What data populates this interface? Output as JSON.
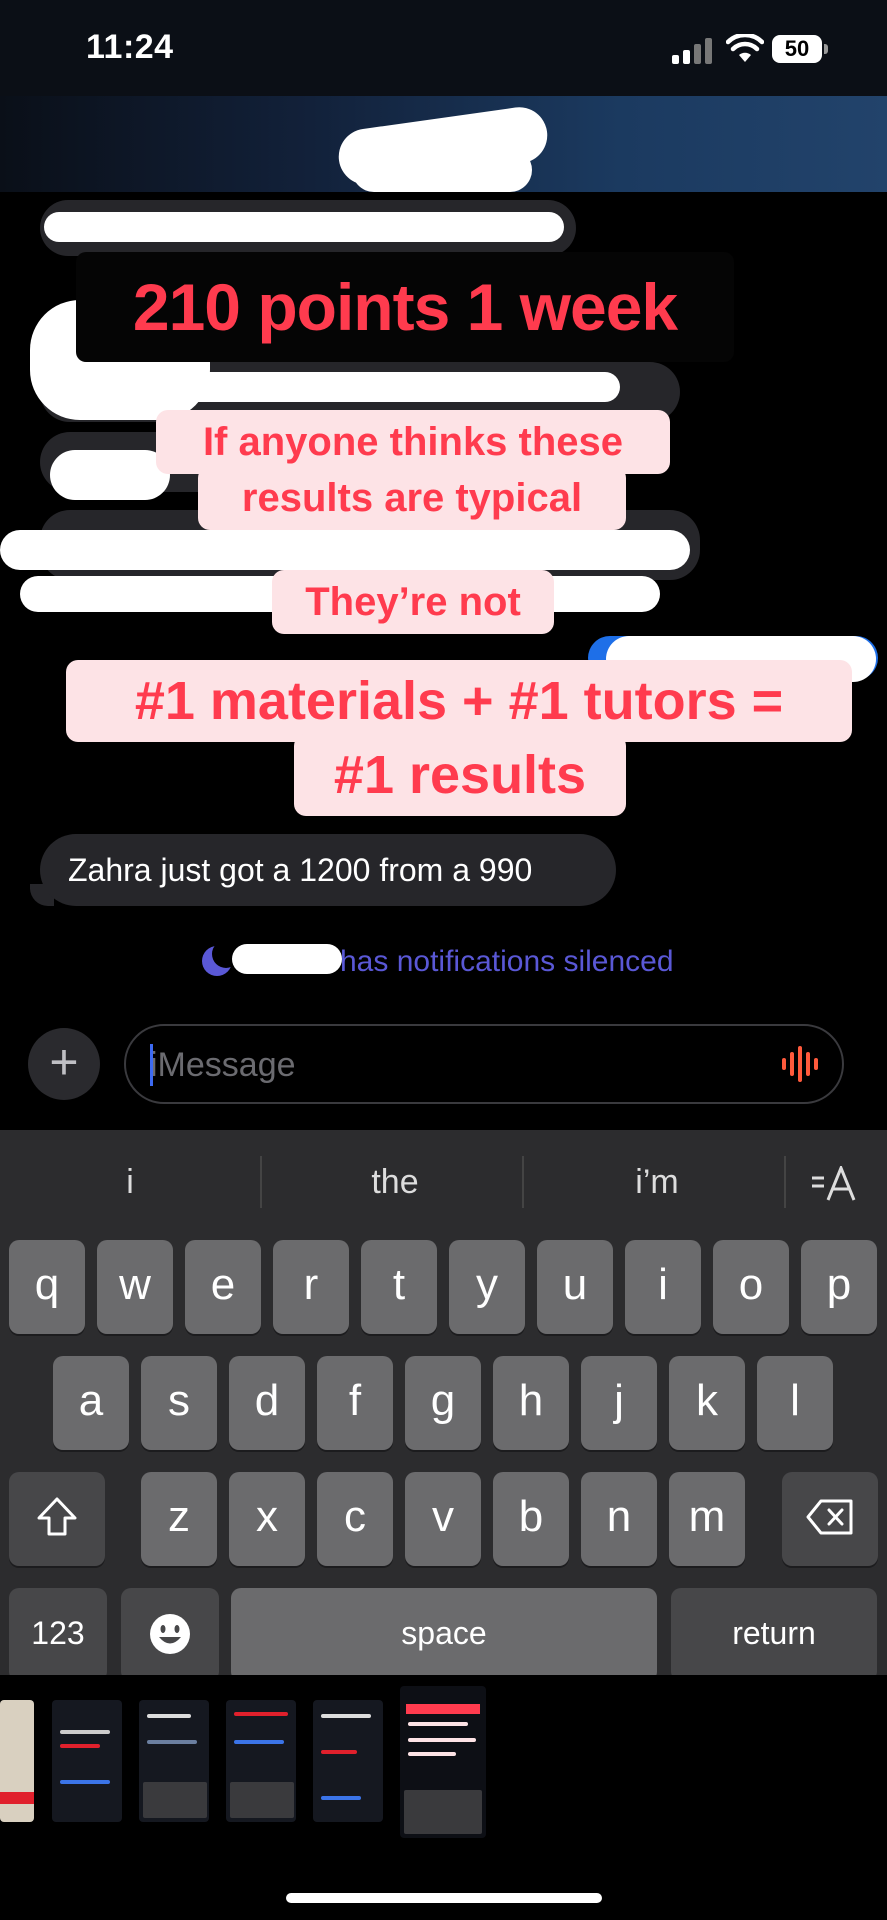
{
  "status_bar": {
    "time": "11:24",
    "battery": "50"
  },
  "overlay": {
    "title": "210 points 1 week",
    "line1": "If anyone thinks these",
    "line2": "results are typical",
    "line3": "They’re not",
    "line4": "#1 materials + #1  tutors =",
    "line5": "#1 results"
  },
  "messages": [
    {
      "sender": "other",
      "text": "Zahra just got a 1200 from a 990"
    }
  ],
  "notice": {
    "text": "has notifications silenced"
  },
  "composer": {
    "placeholder": "iMessage"
  },
  "keyboard": {
    "suggestions": [
      "i",
      "the",
      "i’m"
    ],
    "row1": [
      "q",
      "w",
      "e",
      "r",
      "t",
      "y",
      "u",
      "i",
      "o",
      "p"
    ],
    "row2": [
      "a",
      "s",
      "d",
      "f",
      "g",
      "h",
      "j",
      "k",
      "l"
    ],
    "row3": [
      "z",
      "x",
      "c",
      "v",
      "b",
      "n",
      "m"
    ],
    "numbers_label": "123",
    "space_label": "space",
    "return_label": "return"
  },
  "icons": {
    "plus": "plus-icon",
    "waveform": "waveform-icon",
    "shift": "shift-icon",
    "delete": "delete-icon",
    "emoji": "emoji-icon",
    "format": "text-format-icon",
    "moon": "moon-icon"
  },
  "colors": {
    "caption_red": "#ff3b4e",
    "caption_bg": "#fde3e6",
    "silenced": "#5a58d6",
    "caret": "#3d6af2"
  }
}
